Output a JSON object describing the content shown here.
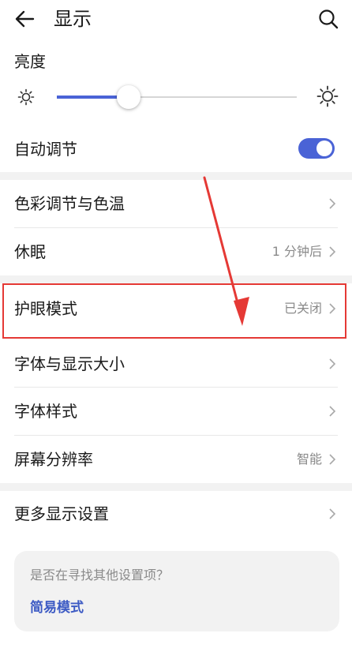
{
  "header": {
    "title": "显示"
  },
  "brightness": {
    "label": "亮度",
    "level_percent": 30
  },
  "auto_adjust": {
    "label": "自动调节",
    "enabled": true
  },
  "items": [
    {
      "label": "色彩调节与色温",
      "value": ""
    },
    {
      "label": "休眠",
      "value": "1 分钟后"
    },
    {
      "label": "护眼模式",
      "value": "已关闭"
    },
    {
      "label": "字体与显示大小",
      "value": ""
    },
    {
      "label": "字体样式",
      "value": ""
    },
    {
      "label": "屏幕分辨率",
      "value": "智能"
    }
  ],
  "more": {
    "label": "更多显示设置"
  },
  "suggestion": {
    "question": "是否在寻找其他设置项？",
    "link": "简易模式"
  },
  "colors": {
    "accent": "#4a63d6",
    "highlight_box": "#e53935",
    "arrow": "#e53935"
  }
}
